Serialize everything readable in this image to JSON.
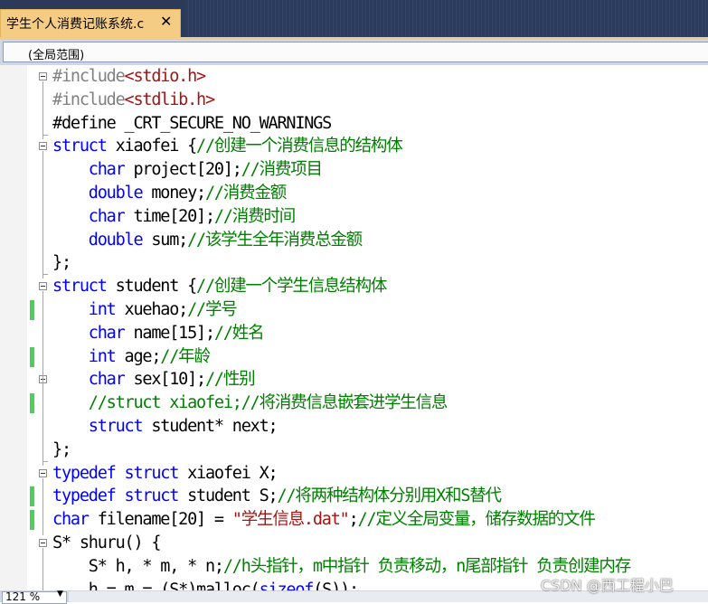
{
  "tab": {
    "title": "学生个人消费记账系统.c",
    "close": "✕"
  },
  "scope": {
    "label": "(全局范围)"
  },
  "code_lines": [
    [
      {
        "t": "#include",
        "c": "pp"
      },
      {
        "t": "<stdio.h>",
        "c": "str"
      }
    ],
    [
      {
        "t": "#include",
        "c": "pp"
      },
      {
        "t": "<stdlib.h>",
        "c": "str"
      }
    ],
    [
      {
        "t": "#define _CRT_SECURE_NO_WARNINGS",
        "c": "tx"
      }
    ],
    [
      {
        "t": "struct",
        "c": "kw"
      },
      {
        "t": " xiaofei {",
        "c": "tx"
      },
      {
        "t": "//创建一个消费信息的结构体",
        "c": "cm"
      }
    ],
    [
      {
        "t": "    ",
        "c": "tx"
      },
      {
        "t": "char",
        "c": "kw"
      },
      {
        "t": " project[20];",
        "c": "tx"
      },
      {
        "t": "//消费项目",
        "c": "cm"
      }
    ],
    [
      {
        "t": "    ",
        "c": "tx"
      },
      {
        "t": "double",
        "c": "kw"
      },
      {
        "t": " money;",
        "c": "tx"
      },
      {
        "t": "//消费金额",
        "c": "cm"
      }
    ],
    [
      {
        "t": "    ",
        "c": "tx"
      },
      {
        "t": "char",
        "c": "kw"
      },
      {
        "t": " time[20];",
        "c": "tx"
      },
      {
        "t": "//消费时间",
        "c": "cm"
      }
    ],
    [
      {
        "t": "    ",
        "c": "tx"
      },
      {
        "t": "double",
        "c": "kw"
      },
      {
        "t": " sum;",
        "c": "tx"
      },
      {
        "t": "//该学生全年消费总金额",
        "c": "cm"
      }
    ],
    [
      {
        "t": "};",
        "c": "tx"
      }
    ],
    [
      {
        "t": "struct",
        "c": "kw"
      },
      {
        "t": " student {",
        "c": "tx"
      },
      {
        "t": "//创建一个学生信息结构体",
        "c": "cm"
      }
    ],
    [
      {
        "t": "    ",
        "c": "tx"
      },
      {
        "t": "int",
        "c": "kw"
      },
      {
        "t": " xuehao;",
        "c": "tx"
      },
      {
        "t": "//学号",
        "c": "cm"
      }
    ],
    [
      {
        "t": "    ",
        "c": "tx"
      },
      {
        "t": "char",
        "c": "kw"
      },
      {
        "t": " name[15];",
        "c": "tx"
      },
      {
        "t": "//姓名",
        "c": "cm"
      }
    ],
    [
      {
        "t": "    ",
        "c": "tx"
      },
      {
        "t": "int",
        "c": "kw"
      },
      {
        "t": " age;",
        "c": "tx"
      },
      {
        "t": "//年龄",
        "c": "cm"
      }
    ],
    [
      {
        "t": "    ",
        "c": "tx"
      },
      {
        "t": "char",
        "c": "kw"
      },
      {
        "t": " sex[10];",
        "c": "tx"
      },
      {
        "t": "//性别",
        "c": "cm"
      }
    ],
    [
      {
        "t": "    ",
        "c": "tx"
      },
      {
        "t": "//struct xiaofei;//将消费信息嵌套进学生信息",
        "c": "cm"
      }
    ],
    [
      {
        "t": "    ",
        "c": "tx"
      },
      {
        "t": "struct",
        "c": "kw"
      },
      {
        "t": " student* next;",
        "c": "tx"
      }
    ],
    [
      {
        "t": "};",
        "c": "tx"
      }
    ],
    [
      {
        "t": "typedef",
        "c": "kw"
      },
      {
        "t": " ",
        "c": "tx"
      },
      {
        "t": "struct",
        "c": "kw"
      },
      {
        "t": " xiaofei X;",
        "c": "tx"
      }
    ],
    [
      {
        "t": "typedef",
        "c": "kw"
      },
      {
        "t": " ",
        "c": "tx"
      },
      {
        "t": "struct",
        "c": "kw"
      },
      {
        "t": " student S;",
        "c": "tx"
      },
      {
        "t": "//将两种结构体分别用X和S替代",
        "c": "cm"
      }
    ],
    [
      {
        "t": "char",
        "c": "kw"
      },
      {
        "t": " filename[20] = ",
        "c": "tx"
      },
      {
        "t": "\"学生信息.dat\"",
        "c": "str"
      },
      {
        "t": ";",
        "c": "tx"
      },
      {
        "t": "//定义全局变量，储存数据的文件",
        "c": "cm"
      }
    ],
    [
      {
        "t": "S* shuru() {",
        "c": "tx"
      }
    ],
    [
      {
        "t": "    S* h, * m, * n;",
        "c": "tx"
      },
      {
        "t": "//h头指针，m中指针 负责移动，n尾部指针 负责创建内存",
        "c": "cm"
      }
    ],
    [
      {
        "t": "    h = m = (S*)malloc(",
        "c": "tx"
      },
      {
        "t": "sizeof",
        "c": "kw"
      },
      {
        "t": "(S));",
        "c": "tx"
      }
    ]
  ],
  "status": {
    "zoom": "121 %",
    "zoom_arrow": "▼"
  },
  "watermark": "CSDN @西工程小巴",
  "colors": {
    "keyword": "#0000ff",
    "comment": "#008000",
    "string": "#a31515",
    "preprocessor": "#808080",
    "change_marker": "#4fce5c",
    "active_tab": "#f5cc84"
  }
}
